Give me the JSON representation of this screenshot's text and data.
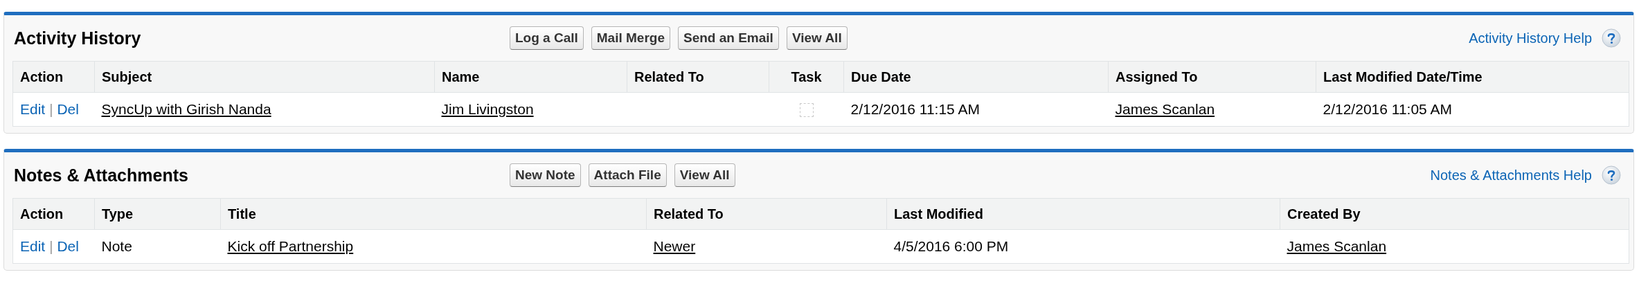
{
  "panels": [
    {
      "title": "Activity History",
      "buttons": [
        "Log a Call",
        "Mail Merge",
        "Send an Email",
        "View All"
      ],
      "help": "Activity History Help",
      "columns": [
        "Action",
        "Subject",
        "Name",
        "Related To",
        "Task",
        "Due Date",
        "Assigned To",
        "Last Modified Date/Time"
      ],
      "rows": [
        {
          "cells": [
            {
              "kind": "actions",
              "links": [
                "Edit",
                "Del"
              ],
              "separator": "|"
            },
            {
              "kind": "link",
              "text": "SyncUp with Girish Nanda"
            },
            {
              "kind": "link",
              "text": "Jim Livingston"
            },
            {
              "kind": "empty"
            },
            {
              "kind": "checkbox",
              "checked": false
            },
            {
              "kind": "text",
              "text": "2/12/2016 11:15 AM"
            },
            {
              "kind": "link",
              "text": "James Scanlan"
            },
            {
              "kind": "text",
              "text": "2/12/2016 11:05 AM"
            }
          ]
        }
      ]
    },
    {
      "title": "Notes & Attachments",
      "buttons": [
        "New Note",
        "Attach File",
        "View All"
      ],
      "help": "Notes & Attachments Help",
      "columns": [
        "Action",
        "Type",
        "Title",
        "Related To",
        "Last Modified",
        "Created By"
      ],
      "rows": [
        {
          "cells": [
            {
              "kind": "actions",
              "links": [
                "Edit",
                "Del"
              ],
              "separator": "|"
            },
            {
              "kind": "text",
              "text": "Note"
            },
            {
              "kind": "link",
              "text": "Kick off Partnership"
            },
            {
              "kind": "link",
              "text": "Newer"
            },
            {
              "kind": "text",
              "text": "4/5/2016 6:00 PM"
            },
            {
              "kind": "link",
              "text": "James Scanlan"
            }
          ]
        }
      ]
    }
  ]
}
